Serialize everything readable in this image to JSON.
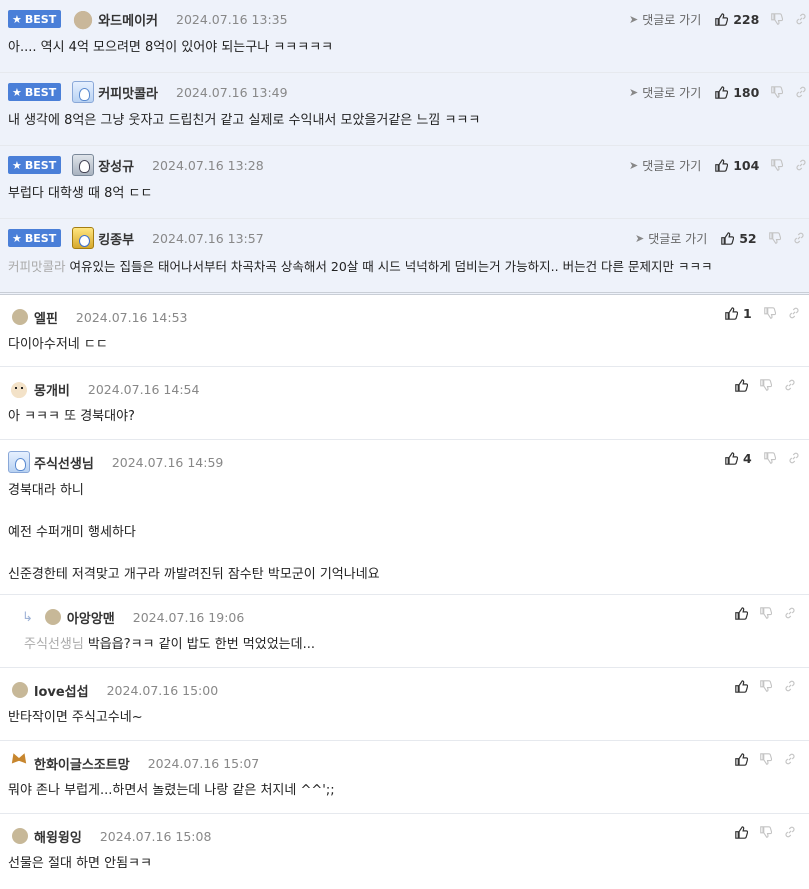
{
  "labels": {
    "best": "BEST",
    "goto": "댓글로 가기"
  },
  "colors": {
    "best_bg": "#eef2fa",
    "badge": "#4a7fd8"
  },
  "comments": [
    {
      "best": true,
      "nick": "와드메이커",
      "date": "2024.07.16 13:35",
      "text": "아.... 역시 4억 모으려면 8억이 있어야 되는구나 ㅋㅋㅋㅋㅋ",
      "likes": "228",
      "avatar": "blob-avatar"
    },
    {
      "best": true,
      "nick": "커피맛콜라",
      "date": "2024.07.16 13:49",
      "text": "내 생각에 8억은 그냥 웃자고 드립친거 같고 실제로 수익내서 모았을거같은 느낌 ㅋㅋㅋ",
      "likes": "180",
      "avatar": "ghost-avatar"
    },
    {
      "best": true,
      "nick": "장성규",
      "date": "2024.07.16 13:28",
      "text": "부럽다 대학생 때 8억 ㄷㄷ",
      "likes": "104",
      "avatar": "ghost-avatar"
    },
    {
      "best": true,
      "nick": "킹종부",
      "date": "2024.07.16 13:57",
      "mention": "커피맛콜라",
      "text": "여유있는 집들은 태어나서부터 차곡차곡 상속해서 20살 때 시드 넉넉하게 덤비는거 가능하지.. 버는건 다른 문제지만 ㅋㅋㅋ",
      "likes": "52",
      "avatar": "king-avatar"
    },
    {
      "nick": "엘핀",
      "date": "2024.07.16 14:53",
      "text": "다이아수저네 ㄷㄷ",
      "likes": "1"
    },
    {
      "nick": "몽개비",
      "date": "2024.07.16 14:54",
      "text": "아 ㅋㅋㅋ 또 경북대야?",
      "likes": ""
    },
    {
      "nick": "주식선생님",
      "date": "2024.07.16 14:59",
      "lines": [
        "경북대라 하니",
        "예전 수퍼개미 행세하다",
        "신준경한테 저격맞고 개구라 까발려진뒤 잠수탄 박모군이 기억나네요"
      ],
      "likes": "4"
    },
    {
      "reply": true,
      "nick": "아앙앙맨",
      "date": "2024.07.16 19:06",
      "mention": "주식선생님",
      "text": "박읍읍?ㅋㅋ 같이 밥도 한번 먹었었는데...",
      "likes": ""
    },
    {
      "nick": "love섭섭",
      "date": "2024.07.16 15:00",
      "text": "반타작이면 주식고수네~",
      "likes": ""
    },
    {
      "nick": "한화이글스조트망",
      "date": "2024.07.16 15:07",
      "text": "뭐야 존나 부럽게...하면서 놀렸는데 나랑 같은 처지네 ^^';;",
      "likes": ""
    },
    {
      "nick": "해윙윙잉",
      "date": "2024.07.16 15:08",
      "text": "선물은 절대 하면 안됨ㅋㅋ",
      "likes": ""
    }
  ]
}
